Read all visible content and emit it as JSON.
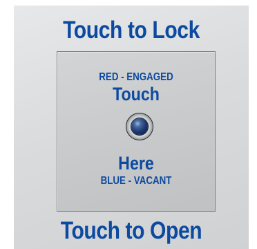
{
  "panel": {
    "top_heading": "Touch to Lock",
    "bottom_heading": "Touch to Open",
    "pad": {
      "status_engaged": "RED - ENGAGED",
      "touch_word": "Touch",
      "here_word": "Here",
      "status_vacant": "BLUE - VACANT"
    },
    "indicator": {
      "icon": "status-led-icon",
      "current_color": "#1d3570"
    },
    "colors": {
      "text": "#0c4aa0",
      "background": "#d9dbdd"
    }
  }
}
